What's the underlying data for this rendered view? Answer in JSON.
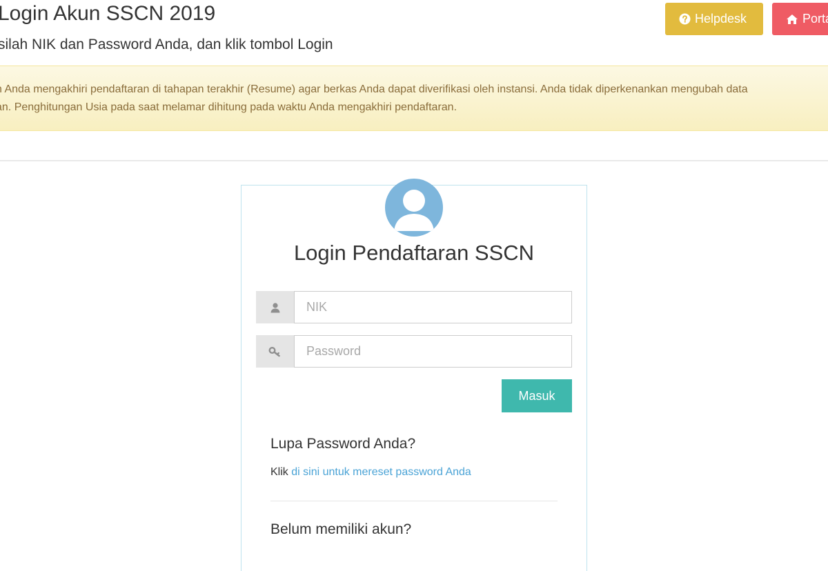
{
  "header": {
    "title": "Login Akun SSCN 2019",
    "subtitle": "silah NIK dan Password Anda, dan klik tombol Login",
    "helpdesk_label": "Helpdesk",
    "helpdesk_icon": "question-circle-icon",
    "helpdesk_color": "#e2bb3e",
    "portal_label": "Portal",
    "portal_icon": "home-icon",
    "portal_color": "#ef5b64"
  },
  "alert": {
    "line1": "n Anda mengakhiri pendaftaran di tahapan terakhir (Resume) agar berkas Anda dapat diverifikasi oleh instansi. Anda tidak diperkenankan mengubah data",
    "line2": "an. Penghitungan Usia pada saat melamar dihitung pada waktu Anda mengakhiri pendaftaran.",
    "text_color": "#8a6d3b",
    "background": "#fcf8e3"
  },
  "login": {
    "avatar_icon": "user-avatar-icon",
    "title": "Login Pendaftaran SSCN",
    "nik_icon": "user-icon",
    "nik_placeholder": "NIK",
    "nik_value": "",
    "password_icon": "key-icon",
    "password_placeholder": "Password",
    "password_value": "",
    "submit_label": "Masuk",
    "submit_color": "#3fb8ad",
    "forgot_heading": "Lupa Password Anda?",
    "forgot_prefix": "Klik",
    "forgot_link": "di sini untuk mereset password Anda",
    "register_heading": "Belum memiliki akun?"
  }
}
